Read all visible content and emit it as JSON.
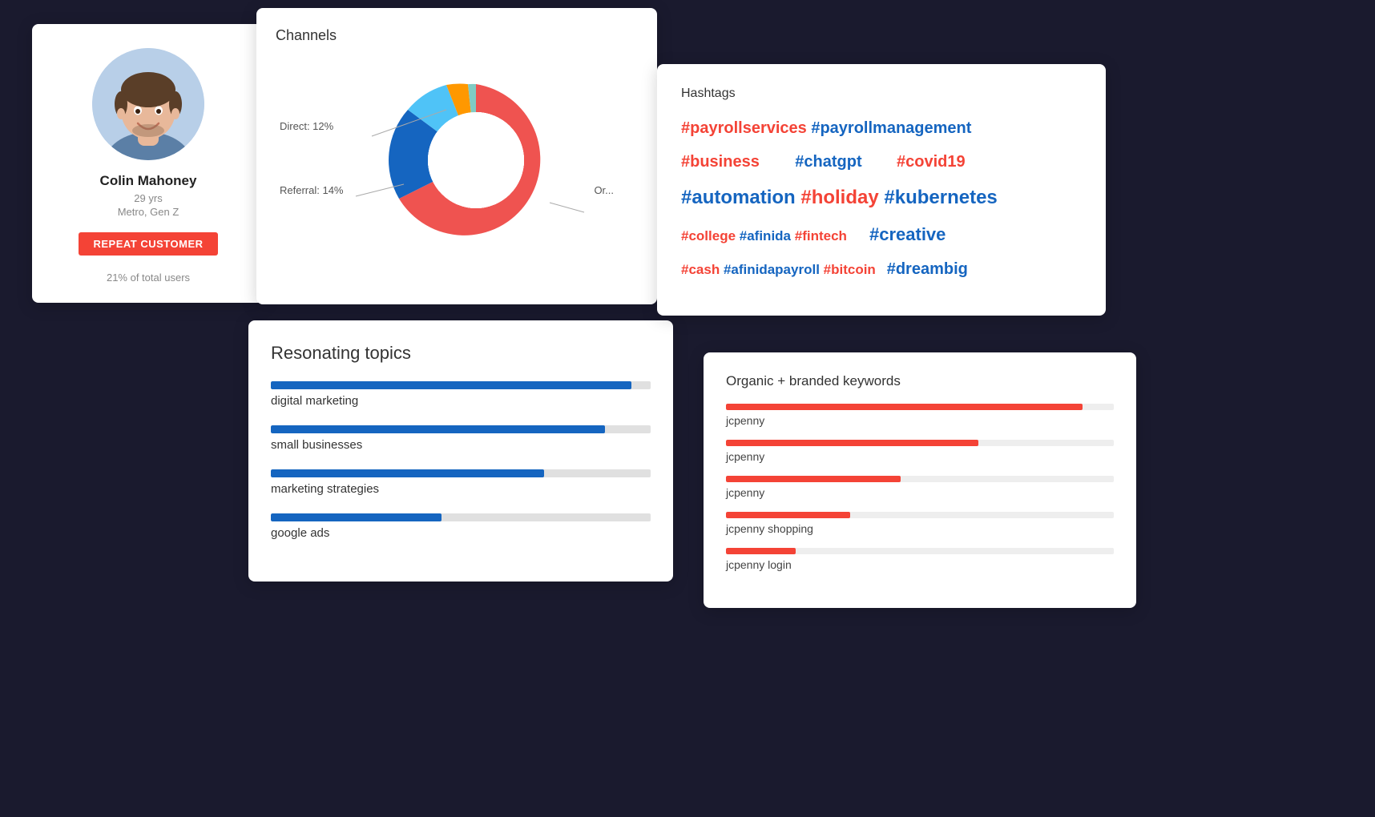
{
  "profile": {
    "name": "Colin Mahoney",
    "age": "29 yrs",
    "demo": "Metro, Gen Z",
    "badge": "REPEAT CUSTOMER",
    "stat": "21% of total users",
    "avatar_desc": "smiling young man"
  },
  "channels": {
    "title": "Channels",
    "labels": {
      "direct": "Direct: 12%",
      "referral": "Referral: 14%",
      "organic": "Or..."
    },
    "segments": [
      {
        "name": "coral",
        "color": "#ef5350",
        "pct": 60,
        "startAngle": -30,
        "endAngle": 186
      },
      {
        "name": "blue",
        "color": "#1565c0",
        "pct": 14,
        "startAngle": 186,
        "endAngle": 237
      },
      {
        "name": "light_blue",
        "color": "#4fc3f7",
        "pct": 12,
        "startAngle": 237,
        "endAngle": 280
      },
      {
        "name": "orange",
        "color": "#ff9800",
        "pct": 8,
        "startAngle": 280,
        "endAngle": 309
      },
      {
        "name": "teal",
        "color": "#80cbc4",
        "pct": 6,
        "startAngle": 309,
        "endAngle": 330
      }
    ]
  },
  "hashtags": {
    "title": "Hashtags",
    "items": [
      {
        "text": "#payrollservices",
        "color": "red"
      },
      {
        "text": "#payrollmanagement",
        "color": "blue"
      },
      {
        "text": "#business",
        "color": "red"
      },
      {
        "text": "#chatgpt",
        "color": "blue"
      },
      {
        "text": "#covid19",
        "color": "red"
      },
      {
        "text": "#automation",
        "color": "blue"
      },
      {
        "text": "#holiday",
        "color": "red"
      },
      {
        "text": "#kubernetes",
        "color": "blue"
      },
      {
        "text": "#college",
        "color": "red"
      },
      {
        "text": "#afinida",
        "color": "blue"
      },
      {
        "text": "#fintech",
        "color": "red"
      },
      {
        "text": "#creative",
        "color": "blue"
      },
      {
        "text": "#cash",
        "color": "red"
      },
      {
        "text": "#afinidapayroll",
        "color": "blue"
      },
      {
        "text": "#bitcoin",
        "color": "red"
      },
      {
        "text": "#dreambig",
        "color": "blue"
      }
    ]
  },
  "topics": {
    "title": "Resonating topics",
    "items": [
      {
        "label": "digital marketing",
        "pct": 95
      },
      {
        "label": "small businesses",
        "pct": 88
      },
      {
        "label": "marketing strategies",
        "pct": 72
      },
      {
        "label": "google ads",
        "pct": 45
      }
    ]
  },
  "keywords": {
    "title": "Organic + branded keywords",
    "items": [
      {
        "label": "jcpenny",
        "pct": 92
      },
      {
        "label": "jcpenny",
        "pct": 65
      },
      {
        "label": "jcpenny",
        "pct": 45
      },
      {
        "label": "jcpenny shopping",
        "pct": 32
      },
      {
        "label": "jcpenny login",
        "pct": 20
      }
    ]
  }
}
